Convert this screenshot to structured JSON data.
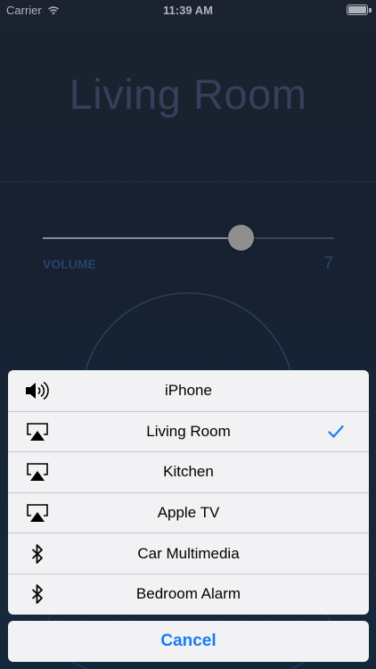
{
  "status_bar": {
    "carrier": "Carrier",
    "time": "11:39 AM",
    "battery_level": 1.0
  },
  "screen": {
    "room_title": "Living Room",
    "volume_label": "VOLUME",
    "volume_value": "7",
    "volume_fraction": 0.68
  },
  "action_sheet": {
    "items": [
      {
        "label": "iPhone",
        "icon": "speaker-icon",
        "selected": false
      },
      {
        "label": "Living Room",
        "icon": "airplay-icon",
        "selected": true
      },
      {
        "label": "Kitchen",
        "icon": "airplay-icon",
        "selected": false
      },
      {
        "label": "Apple TV",
        "icon": "airplay-icon",
        "selected": false
      },
      {
        "label": "Car Multimedia",
        "icon": "bluetooth-icon",
        "selected": false
      },
      {
        "label": "Bedroom Alarm",
        "icon": "bluetooth-icon",
        "selected": false
      }
    ],
    "cancel_label": "Cancel"
  },
  "colors": {
    "accent": "#1a7cf5",
    "sheet_background": "#f2f2f4"
  }
}
